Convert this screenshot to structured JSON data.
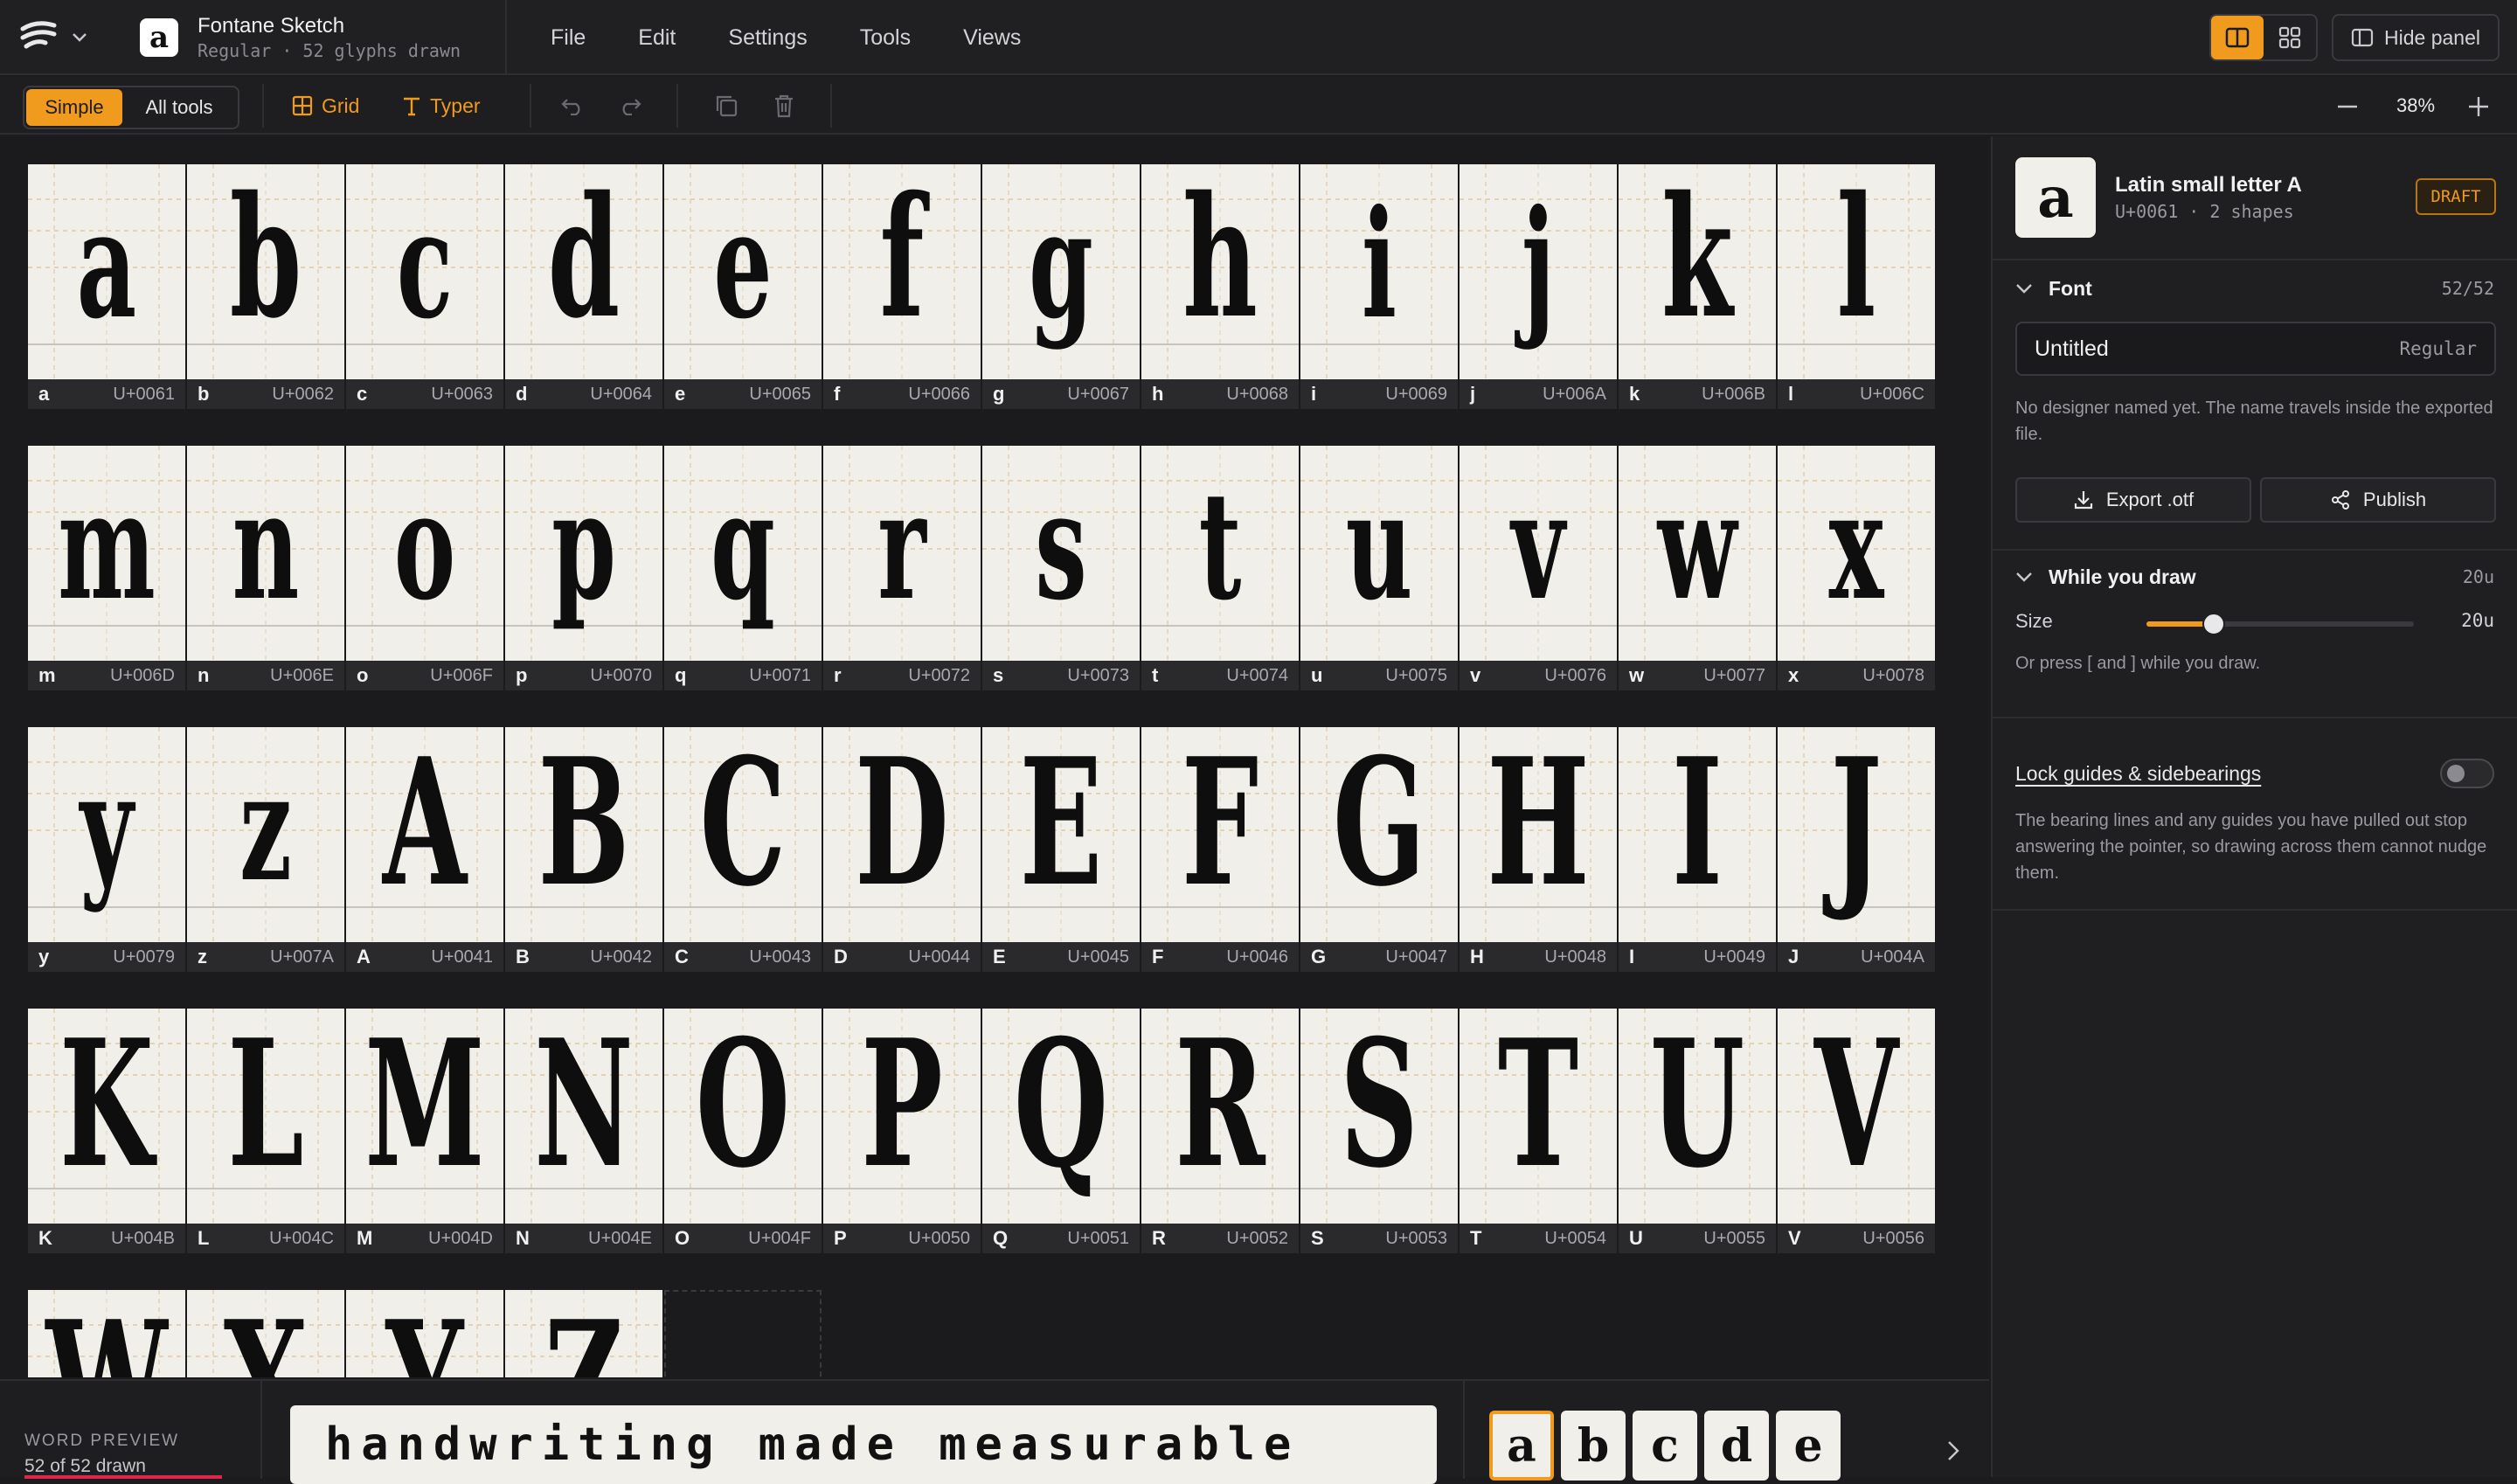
{
  "header": {
    "app_icon_glyph": "a",
    "font_name": "Fontane Sketch",
    "font_meta": "Regular · 52 glyphs drawn",
    "menu": [
      "File",
      "Edit",
      "Settings",
      "Tools",
      "Views"
    ],
    "hide_panel_label": "Hide panel"
  },
  "toolbar": {
    "mode_simple": "Simple",
    "mode_all": "All tools",
    "grid_label": "Grid",
    "typer_label": "Typer",
    "zoom": "38%"
  },
  "glyphs": [
    {
      "ch": "a",
      "code": "U+0061"
    },
    {
      "ch": "b",
      "code": "U+0062"
    },
    {
      "ch": "c",
      "code": "U+0063"
    },
    {
      "ch": "d",
      "code": "U+0064"
    },
    {
      "ch": "e",
      "code": "U+0065"
    },
    {
      "ch": "f",
      "code": "U+0066"
    },
    {
      "ch": "g",
      "code": "U+0067"
    },
    {
      "ch": "h",
      "code": "U+0068"
    },
    {
      "ch": "i",
      "code": "U+0069"
    },
    {
      "ch": "j",
      "code": "U+006A"
    },
    {
      "ch": "k",
      "code": "U+006B"
    },
    {
      "ch": "l",
      "code": "U+006C"
    },
    {
      "ch": "m",
      "code": "U+006D"
    },
    {
      "ch": "n",
      "code": "U+006E"
    },
    {
      "ch": "o",
      "code": "U+006F"
    },
    {
      "ch": "p",
      "code": "U+0070"
    },
    {
      "ch": "q",
      "code": "U+0071"
    },
    {
      "ch": "r",
      "code": "U+0072"
    },
    {
      "ch": "s",
      "code": "U+0073"
    },
    {
      "ch": "t",
      "code": "U+0074"
    },
    {
      "ch": "u",
      "code": "U+0075"
    },
    {
      "ch": "v",
      "code": "U+0076"
    },
    {
      "ch": "w",
      "code": "U+0077"
    },
    {
      "ch": "x",
      "code": "U+0078"
    },
    {
      "ch": "y",
      "code": "U+0079"
    },
    {
      "ch": "z",
      "code": "U+007A"
    },
    {
      "ch": "A",
      "code": "U+0041"
    },
    {
      "ch": "B",
      "code": "U+0042"
    },
    {
      "ch": "C",
      "code": "U+0043"
    },
    {
      "ch": "D",
      "code": "U+0044"
    },
    {
      "ch": "E",
      "code": "U+0045"
    },
    {
      "ch": "F",
      "code": "U+0046"
    },
    {
      "ch": "G",
      "code": "U+0047"
    },
    {
      "ch": "H",
      "code": "U+0048"
    },
    {
      "ch": "I",
      "code": "U+0049"
    },
    {
      "ch": "J",
      "code": "U+004A"
    },
    {
      "ch": "K",
      "code": "U+004B"
    },
    {
      "ch": "L",
      "code": "U+004C"
    },
    {
      "ch": "M",
      "code": "U+004D"
    },
    {
      "ch": "N",
      "code": "U+004E"
    },
    {
      "ch": "O",
      "code": "U+004F"
    },
    {
      "ch": "P",
      "code": "U+0050"
    },
    {
      "ch": "Q",
      "code": "U+0051"
    },
    {
      "ch": "R",
      "code": "U+0052"
    },
    {
      "ch": "S",
      "code": "U+0053"
    },
    {
      "ch": "T",
      "code": "U+0054"
    },
    {
      "ch": "U",
      "code": "U+0055"
    },
    {
      "ch": "V",
      "code": "U+0056"
    },
    {
      "ch": "W",
      "code": ""
    },
    {
      "ch": "X",
      "code": ""
    },
    {
      "ch": "Y",
      "code": ""
    },
    {
      "ch": "Z",
      "code": ""
    }
  ],
  "panel": {
    "glyph_char": "a",
    "glyph_name": "Latin small letter A",
    "glyph_meta": "U+0061 · 2 shapes",
    "badge": "DRAFT",
    "font_section": "Font",
    "font_count": "52/52",
    "font_name_value": "Untitled",
    "font_style": "Regular",
    "designer_note": "No designer named yet. The name travels inside the exported file.",
    "export_label": "Export .otf",
    "publish_label": "Publish",
    "draw_section": "While you draw",
    "draw_value": "20u",
    "size_label": "Size",
    "size_value": "20u",
    "size_fraction": 0.25,
    "size_hint": "Or press [ and ] while you draw.",
    "lock_label": "Lock guides & sidebearings",
    "lock_on": false,
    "lock_note": "The bearing lines and any guides you have pulled out stop answering the pointer, so drawing across them cannot nudge them."
  },
  "preview": {
    "label": "WORD PREVIEW",
    "count": "52 of 52 drawn",
    "text": "handwriting made measurable",
    "chips": [
      "a",
      "b",
      "c",
      "d",
      "e"
    ]
  },
  "colors": {
    "accent": "#f09a1e",
    "bg": "#1c1c1e",
    "paper": "#f1efea"
  }
}
